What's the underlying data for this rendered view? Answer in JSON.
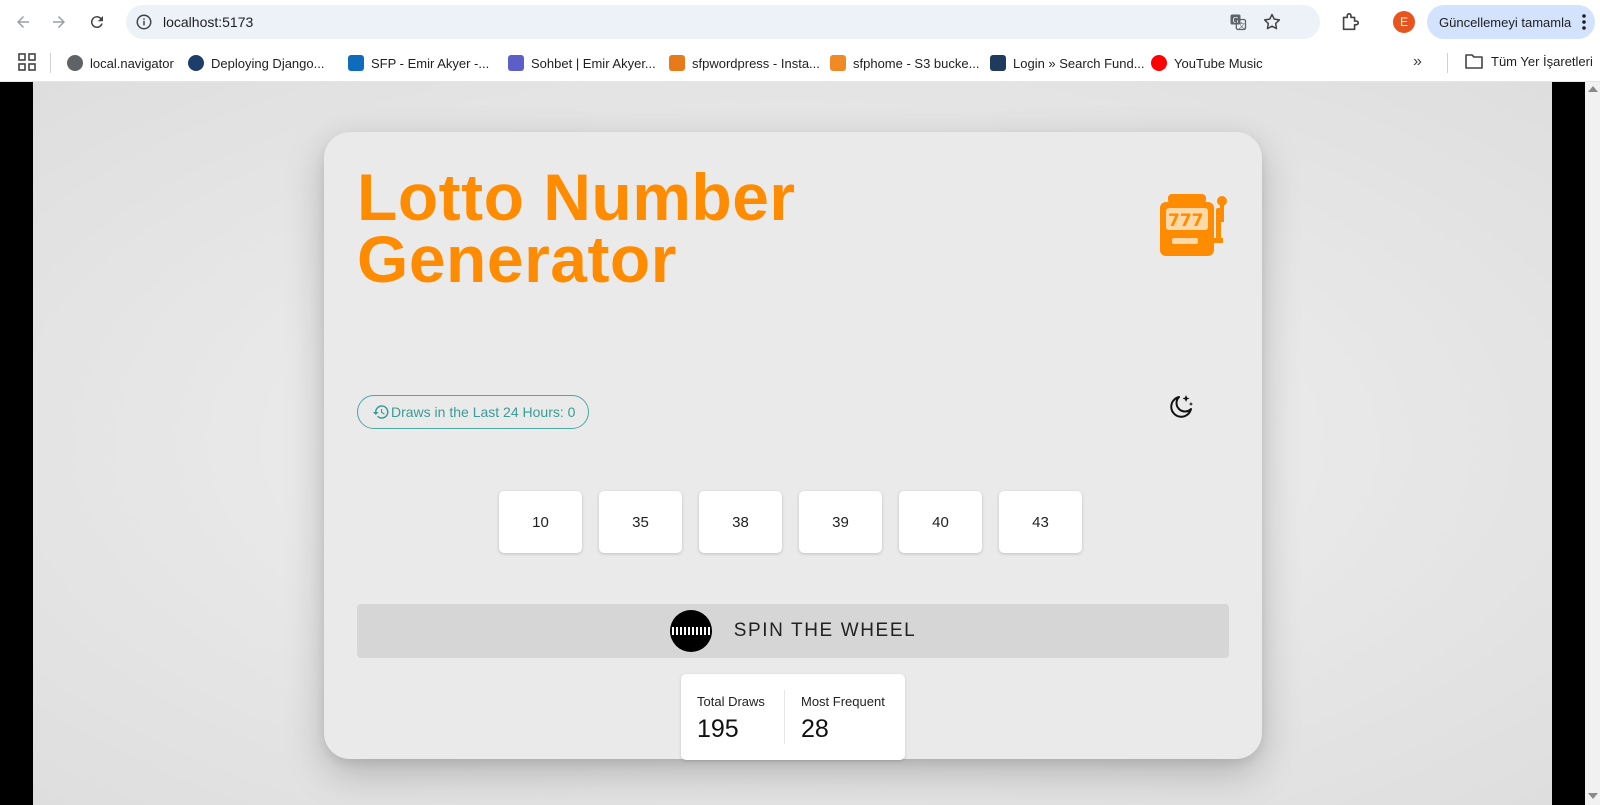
{
  "browser": {
    "url": "localhost:5173",
    "profile_initial": "E",
    "update_label": "Güncellemeyi tamamla",
    "bookmarks": [
      {
        "label": "local.navigator",
        "icon": "globe-icon",
        "color": "#5f6368"
      },
      {
        "label": "Deploying Django...",
        "icon": "python-icon",
        "color": "#1d3d6b"
      },
      {
        "label": "SFP - Emir Akyer -...",
        "icon": "outlook-icon",
        "color": "#0f6cbd"
      },
      {
        "label": "Sohbet | Emir Akyer...",
        "icon": "teams-icon",
        "color": "#5b5fc7"
      },
      {
        "label": "sfpwordpress - Insta...",
        "icon": "lightsail-icon",
        "color": "#e77b1a"
      },
      {
        "label": "sfphome - S3 bucke...",
        "icon": "aws-s3-icon",
        "color": "#f08a24"
      },
      {
        "label": "Login » Search Fund...",
        "icon": "pipedrive-icon",
        "color": "#1e3a5f"
      },
      {
        "label": "YouTube Music",
        "icon": "youtube-music-icon",
        "color": "#ff0000"
      }
    ],
    "all_bookmarks_label": "Tüm Yer İşaretleri"
  },
  "app": {
    "title": "Lotto Number Generator",
    "accent_color": "#ff8c00",
    "draws_chip": "Draws in the Last 24 Hours: 0",
    "numbers": [
      "10",
      "35",
      "38",
      "39",
      "40",
      "43"
    ],
    "spin_label": "SPIN THE WHEEL",
    "stats": {
      "total_label": "Total Draws",
      "total_value": "195",
      "frequent_label": "Most Frequent",
      "frequent_value": "28"
    }
  }
}
